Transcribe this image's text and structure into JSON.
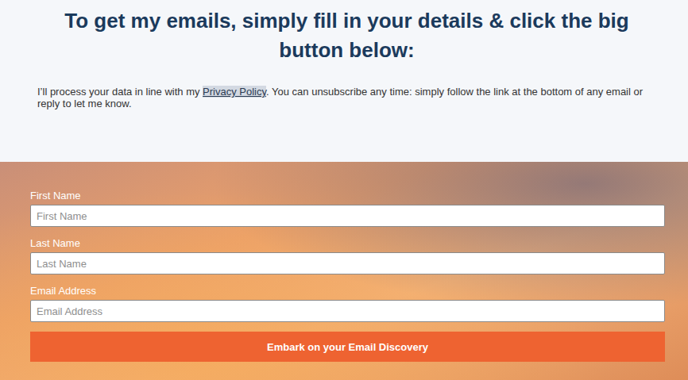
{
  "heading": "To get my emails, simply fill in your details & click the big button below:",
  "notice": {
    "before": "I’ll process your data in line with my ",
    "link": "Privacy Policy",
    "after": ". You can unsubscribe any time: simply follow the link at the bottom of any email or reply to let me know."
  },
  "form": {
    "fields": [
      {
        "label": "First Name",
        "placeholder": "First Name"
      },
      {
        "label": "Last Name",
        "placeholder": "Last Name"
      },
      {
        "label": "Email Address",
        "placeholder": "Email Address"
      }
    ],
    "button": "Embark on your Email Discovery"
  }
}
